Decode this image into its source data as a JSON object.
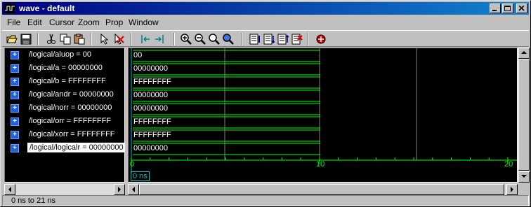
{
  "window": {
    "title": "wave - default"
  },
  "menu": [
    "File",
    "Edit",
    "Cursor",
    "Zoom",
    "Prop",
    "Window"
  ],
  "signals": [
    {
      "label": "/logical/aluop = 00",
      "value": "00"
    },
    {
      "label": "/logical/a = 00000000",
      "value": "00000000"
    },
    {
      "label": "/logical/b = FFFFFFFF",
      "value": "FFFFFFFF"
    },
    {
      "label": "/logical/andr = 00000000",
      "value": "00000000"
    },
    {
      "label": "/logical/norr = 00000000",
      "value": "00000000"
    },
    {
      "label": "/logical/orr = FFFFFFFF",
      "value": "FFFFFFFF"
    },
    {
      "label": "/logical/xorr = FFFFFFFF",
      "value": "FFFFFFFF"
    },
    {
      "label": "/logical/logicalr = 00000000",
      "value": "00000000"
    }
  ],
  "selected_signal": "/logical/logicalr = 00000000",
  "timeline": {
    "labels": [
      "0",
      "10",
      "20"
    ],
    "axis_color": "#00ff00"
  },
  "cursor": {
    "label": "0 ns"
  },
  "status": {
    "range": "0 ns to 21 ns"
  },
  "toolbar_icons": [
    "open-icon",
    "save-icon",
    "cut-icon",
    "copy-icon",
    "paste-icon",
    "select-pointer-icon",
    "delete-icon",
    "zoom-range-icon",
    "zoom-in-icon",
    "zoom-out-icon",
    "zoom-full-icon",
    "zoom-area-icon",
    "add-wave-icon",
    "sort-icon",
    "insert-icon",
    "remove-icon",
    "break-icon"
  ]
}
